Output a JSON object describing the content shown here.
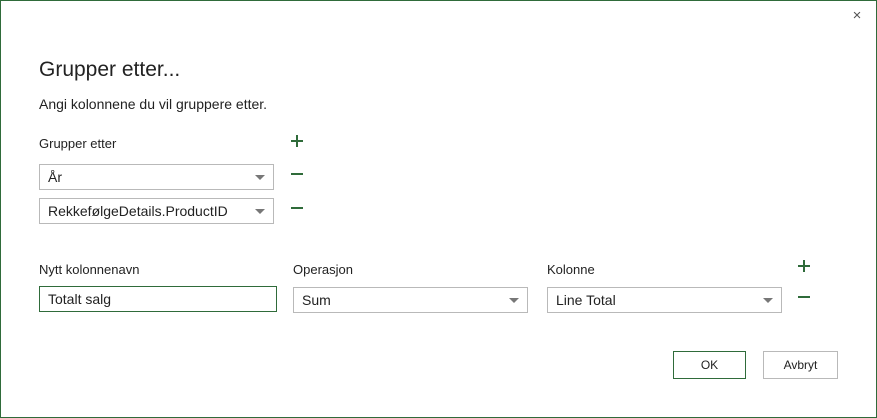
{
  "dialog": {
    "close_glyph": "×",
    "title": "Grupper etter...",
    "subtitle": "Angi kolonnene du vil gruppere etter."
  },
  "group_by": {
    "label": "Grupper etter",
    "rows": [
      {
        "value": "År"
      },
      {
        "value": "RekkefølgeDetails.ProductID"
      }
    ]
  },
  "aggregation": {
    "new_column_label": "Nytt kolonnenavn",
    "operation_label": "Operasjon",
    "column_label": "Kolonne",
    "new_column_value": "Totalt salg",
    "operation_value": "Sum",
    "column_value": "Line Total"
  },
  "buttons": {
    "ok": "OK",
    "cancel": "Avbryt"
  },
  "colors": {
    "accent": "#2f6b3a",
    "border": "#b9b9b9"
  }
}
